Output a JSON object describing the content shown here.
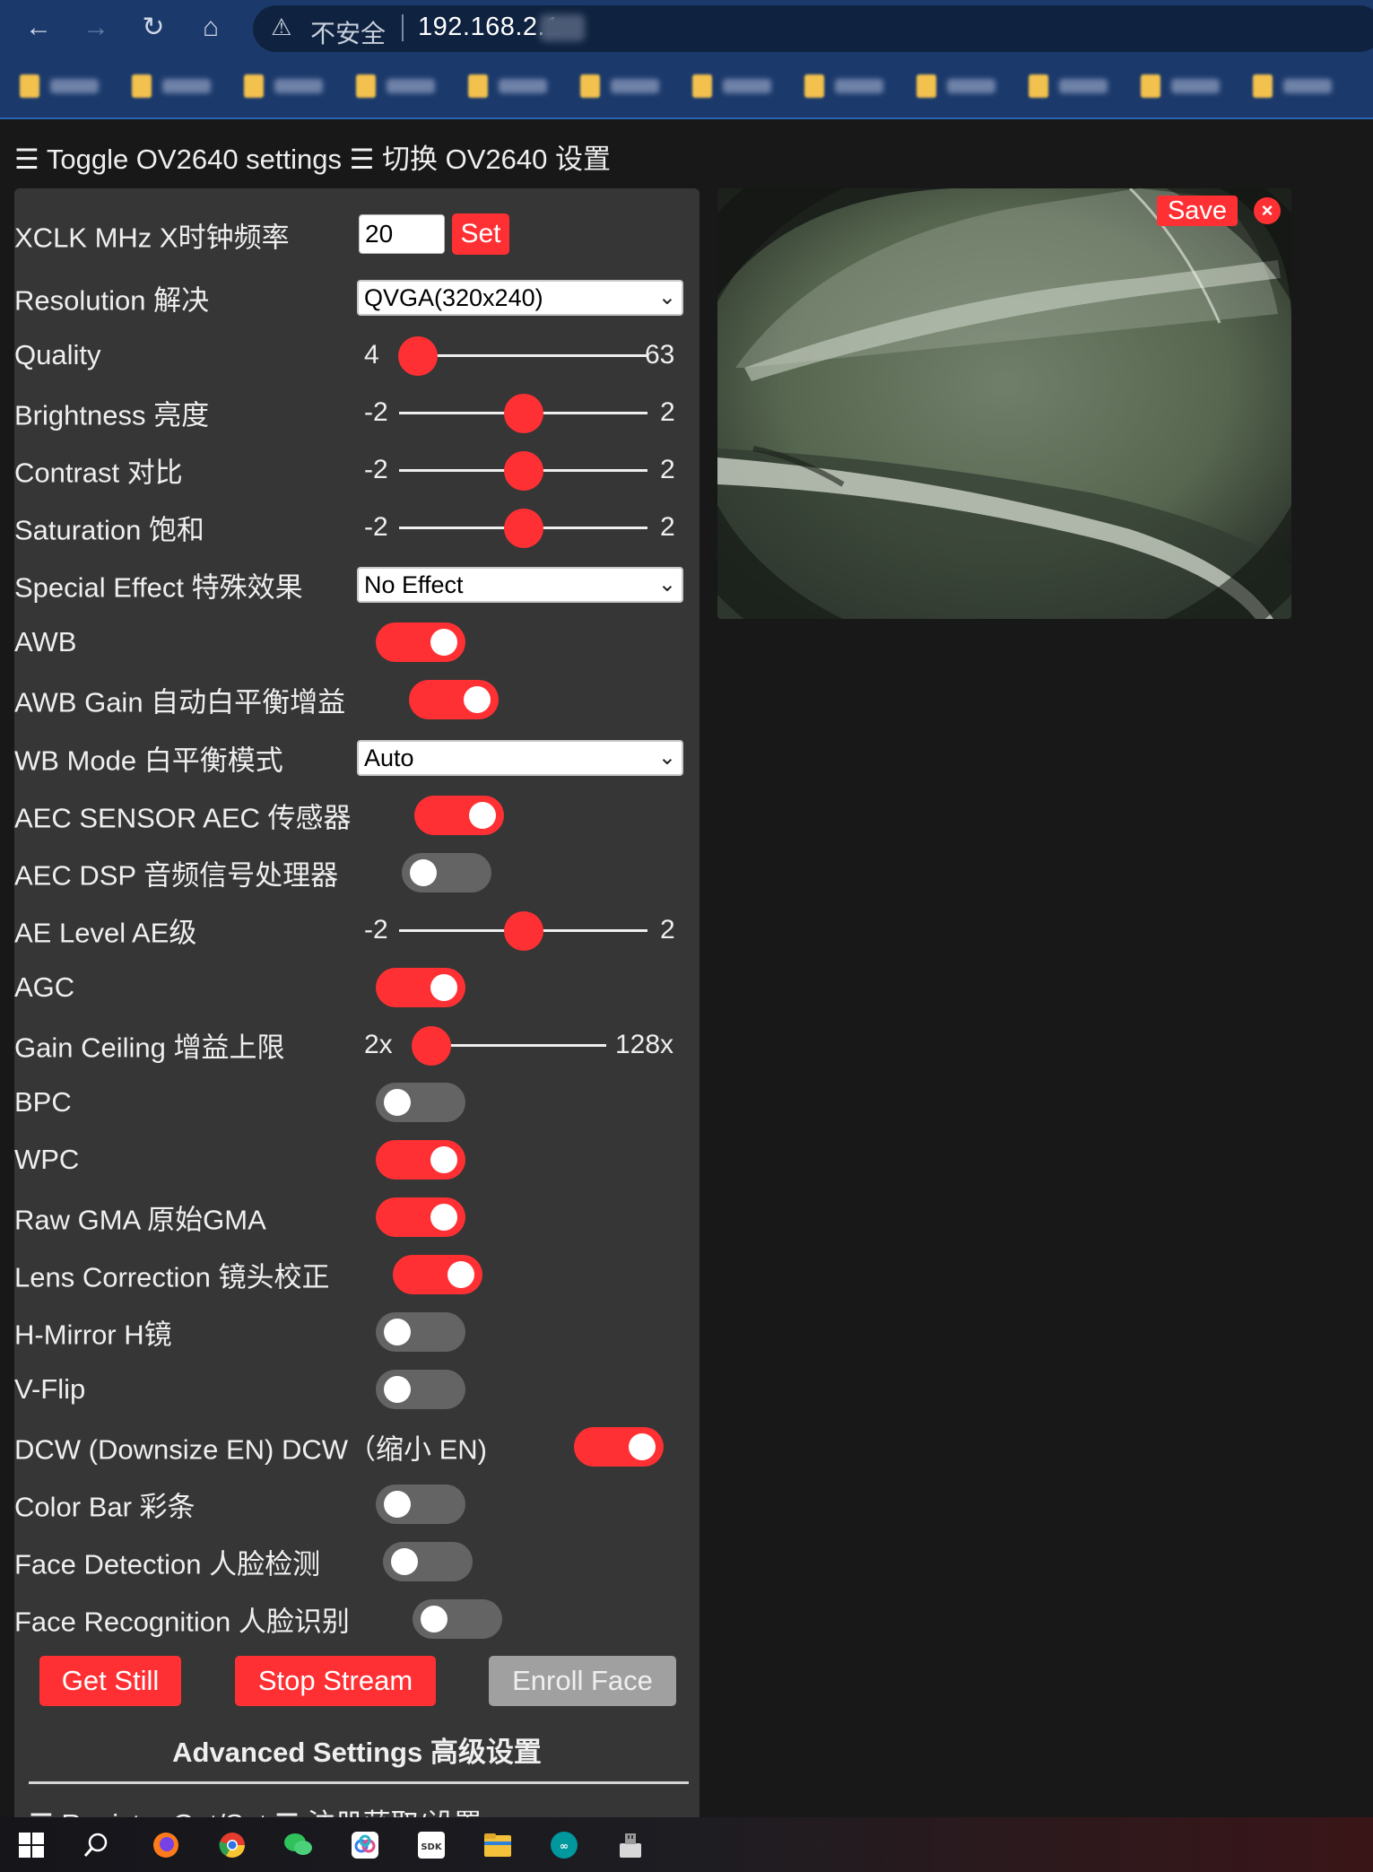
{
  "browser": {
    "security_label": "不安全",
    "url": "192.168.2.1",
    "bookmarks": [
      "",
      "",
      "",
      "",
      "",
      "",
      "",
      "",
      "",
      "",
      "",
      ""
    ]
  },
  "header": {
    "toggle_settings": "☰ Toggle OV2640 settings ☰ 切换 OV2640 设置"
  },
  "settings": {
    "xclk": {
      "label": "XCLK MHz X时钟频率",
      "value": "20",
      "set_label": "Set"
    },
    "resolution": {
      "label": "Resolution 解决",
      "selected": "QVGA(320x240)"
    },
    "quality": {
      "label": "Quality",
      "min": "4",
      "max": "63",
      "value": 4
    },
    "brightness": {
      "label": "Brightness 亮度",
      "min": "-2",
      "max": "2",
      "value": 0
    },
    "contrast": {
      "label": "Contrast 对比",
      "min": "-2",
      "max": "2",
      "value": 0
    },
    "saturation": {
      "label": "Saturation 饱和",
      "min": "-2",
      "max": "2",
      "value": 0
    },
    "special_effect": {
      "label": "Special Effect 特殊效果",
      "selected": "No Effect"
    },
    "awb": {
      "label": "AWB",
      "on": true
    },
    "awb_gain": {
      "label": "AWB Gain 自动白平衡增益",
      "on": true
    },
    "wb_mode": {
      "label": "WB Mode 白平衡模式",
      "selected": "Auto"
    },
    "aec_sensor": {
      "label": "AEC SENSOR AEC 传感器",
      "on": true
    },
    "aec_dsp": {
      "label": "AEC DSP 音频信号处理器",
      "on": false
    },
    "ae_level": {
      "label": "AE Level AE级",
      "min": "-2",
      "max": "2",
      "value": 0
    },
    "agc": {
      "label": "AGC",
      "on": true
    },
    "gain_ceiling": {
      "label": "Gain Ceiling 增益上限",
      "min": "2x",
      "max": "128x",
      "value": 0
    },
    "bpc": {
      "label": "BPC",
      "on": false
    },
    "wpc": {
      "label": "WPC",
      "on": true
    },
    "raw_gma": {
      "label": "Raw GMA 原始GMA",
      "on": true
    },
    "lens_correction": {
      "label": "Lens Correction 镜头校正",
      "on": true
    },
    "hmirror": {
      "label": "H-Mirror H镜",
      "on": false
    },
    "vflip": {
      "label": "V-Flip",
      "on": false
    },
    "dcw": {
      "label": "DCW (Downsize EN) DCW（缩小 EN)",
      "on": true
    },
    "colorbar": {
      "label": "Color Bar 彩条",
      "on": false
    },
    "face_detect": {
      "label": "Face Detection 人脸检测",
      "on": false
    },
    "face_recognize": {
      "label": "Face Recognition 人脸识别",
      "on": false
    }
  },
  "actions": {
    "get_still": "Get Still",
    "stop_stream": "Stop Stream",
    "enroll_face": "Enroll Face"
  },
  "advanced": {
    "title": "Advanced Settings 高级设置",
    "register_label": "☰ Register Get/Set ☰ 注册获取/设置"
  },
  "preview": {
    "save_label": "Save",
    "close_label": "×"
  },
  "colors": {
    "accent": "#ff3034",
    "panel": "#363636",
    "background": "#181818",
    "switch_off": "#646464"
  },
  "taskbar": {
    "icons": [
      "windows-start-icon",
      "search-icon",
      "firefox-icon",
      "chrome-icon",
      "wechat-icon",
      "cloud-drive-icon",
      "sdk-icon",
      "file-explorer-icon",
      "arduino-icon",
      "usb-tool-icon"
    ]
  }
}
